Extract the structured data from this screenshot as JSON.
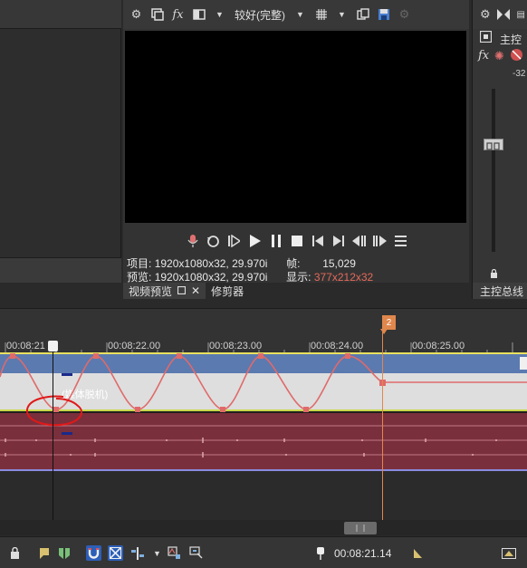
{
  "preview_toolbar": {
    "quality_label": "较好(完整)"
  },
  "transport": {
    "buttons": [
      "record",
      "loop",
      "play-from-start",
      "play",
      "pause",
      "stop",
      "prev-frame",
      "next-frame",
      "prev-marker",
      "next-marker",
      "menu"
    ]
  },
  "info": {
    "project_label": "项目:",
    "project_value": "1920x1080x32, 29.970i",
    "preview_label": "预览:",
    "preview_value": "1920x1080x32, 29.970i",
    "frame_label": "帧:",
    "frame_value": "15,029",
    "display_label": "显示:",
    "display_value": "377x212x32"
  },
  "tabs": {
    "video_preview": "视频预览",
    "trimmer": "修剪器",
    "master_bus": "主控总线"
  },
  "master": {
    "label": "主控",
    "db_value": "-32"
  },
  "timeline": {
    "marker_number": "2",
    "ruler_labels": [
      "00:08:21",
      "00:08:22.00",
      "00:08:23.00",
      "00:08:24.00",
      "00:08:25.00"
    ],
    "caption": "(媒体脱机)",
    "timecode": "00:08:21.14"
  },
  "colors": {
    "video_track_header": "#5b7ab0",
    "audio_track": "#7a2f3c",
    "envelope": "#e06a6a",
    "marker": "#e0874d",
    "annotation": "#e01818"
  }
}
